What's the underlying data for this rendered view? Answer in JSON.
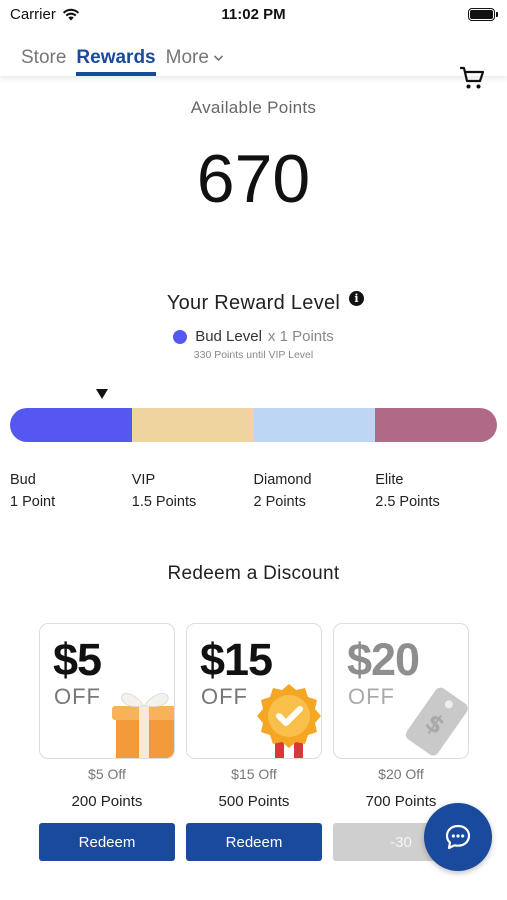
{
  "status_bar": {
    "carrier": "Carrier",
    "time": "11:02 PM"
  },
  "nav": {
    "tabs": [
      {
        "label": "Store"
      },
      {
        "label": "Rewards"
      },
      {
        "label": "More"
      }
    ],
    "active_tab": "Rewards",
    "cart_icon": "cart-icon",
    "more_icon": "chevron-down-icon"
  },
  "points": {
    "label": "Available Points",
    "value": "670"
  },
  "reward_level": {
    "title": "Your Reward Level",
    "info_icon": "info-icon",
    "current_level": "Bud Level",
    "multiplier": "x 1 Points",
    "until_next": "330 Points until VIP Level",
    "current_color": "#5558f0"
  },
  "tiers": [
    {
      "name": "Bud",
      "points": "1 Point",
      "color": "#5558f0"
    },
    {
      "name": "VIP",
      "points": "1.5 Points",
      "color": "#efd4a0"
    },
    {
      "name": "Diamond",
      "points": "2 Points",
      "color": "#bcd6f4"
    },
    {
      "name": "Elite",
      "points": "2.5 Points",
      "color": "#b06a88"
    }
  ],
  "redeem": {
    "title": "Redeem a Discount",
    "cards": [
      {
        "amount": "$5",
        "off": "OFF",
        "desc": "$5 Off",
        "points": "200 Points",
        "button": "Redeem",
        "enabled": true,
        "art_icon": "gift-box-icon"
      },
      {
        "amount": "$15",
        "off": "OFF",
        "desc": "$15 Off",
        "points": "500 Points",
        "button": "Redeem",
        "enabled": true,
        "art_icon": "award-badge-icon"
      },
      {
        "amount": "$20",
        "off": "OFF",
        "desc": "$20 Off",
        "points": "700 Points",
        "button": "-30",
        "enabled": false,
        "art_icon": "price-tag-icon"
      }
    ]
  },
  "chat": {
    "icon": "chat-bubble-icon"
  },
  "colors": {
    "primary": "#1a4a9c",
    "disabled": "#cfcfcf"
  }
}
